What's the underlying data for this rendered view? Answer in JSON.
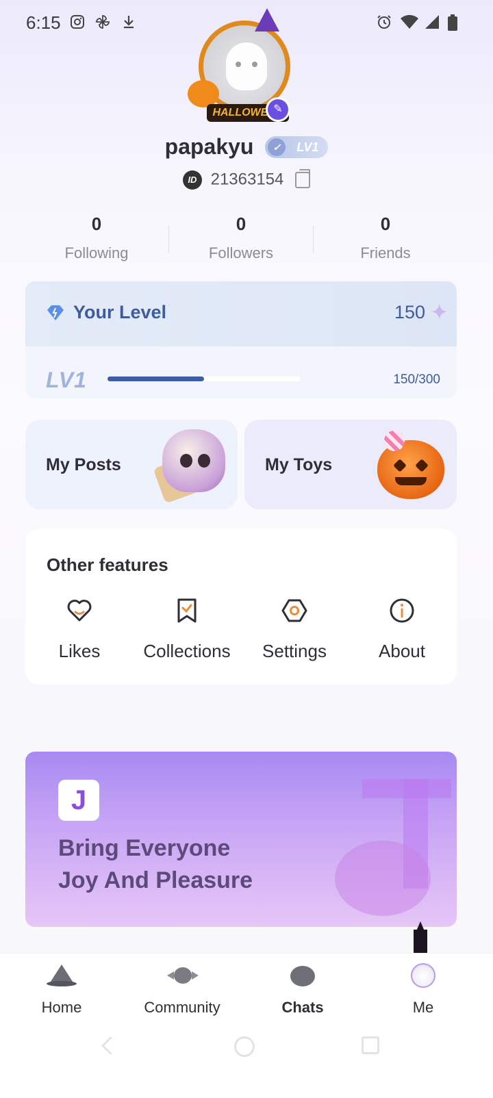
{
  "status_bar": {
    "time": "6:15",
    "left_icons": [
      "instagram-icon",
      "pinwheel-icon",
      "download-icon"
    ],
    "right_icons": [
      "alarm-icon",
      "wifi-icon",
      "signal-icon",
      "battery-icon"
    ]
  },
  "profile": {
    "username": "papakyu",
    "level_badge": "LV1",
    "id_label": "ID",
    "id_value": "21363154",
    "avatar_frame_text": "HALLOWEEN"
  },
  "stats": [
    {
      "value": "0",
      "label": "Following"
    },
    {
      "value": "0",
      "label": "Followers"
    },
    {
      "value": "0",
      "label": "Friends"
    }
  ],
  "level_card": {
    "title": "Your Level",
    "points": "150",
    "level": "LV1",
    "progress_text": "150/300",
    "progress_fraction": 0.5
  },
  "feature_cards": {
    "posts": "My Posts",
    "toys": "My Toys"
  },
  "other_features": {
    "title": "Other features",
    "items": [
      {
        "label": "Likes",
        "icon": "heart-icon"
      },
      {
        "label": "Collections",
        "icon": "bookmark-icon"
      },
      {
        "label": "Settings",
        "icon": "settings-icon"
      },
      {
        "label": "About",
        "icon": "info-icon"
      }
    ]
  },
  "banner": {
    "line1": "Bring Everyone",
    "line2": "Joy And Pleasure",
    "logo_glyph": "J"
  },
  "bottom_nav": [
    {
      "label": "Home",
      "icon": "witch-hat-icon"
    },
    {
      "label": "Community",
      "icon": "candy-icon"
    },
    {
      "label": "Chats",
      "icon": "pumpkin-icon"
    },
    {
      "label": "Me",
      "icon": "avatar-icon"
    }
  ],
  "colors": {
    "accent_blue": "#3d5b9e",
    "accent_orange": "#ef8a3a",
    "banner_purple": "#a78af2"
  }
}
